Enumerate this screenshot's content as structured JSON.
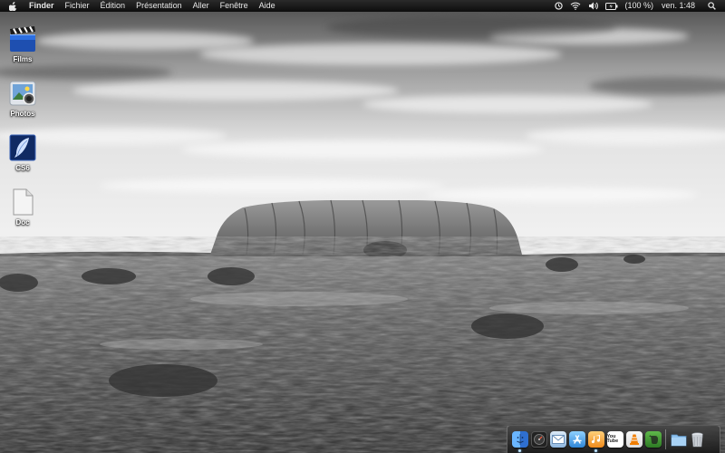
{
  "menubar": {
    "app_name": "Finder",
    "items": [
      "Fichier",
      "Édition",
      "Présentation",
      "Aller",
      "Fenêtre",
      "Aide"
    ],
    "status": {
      "battery": "(100 %)",
      "clock": "ven. 1:48"
    }
  },
  "desktop": {
    "icons": [
      {
        "label": "Films",
        "icon": "clapperboard-icon"
      },
      {
        "label": "Photos",
        "icon": "photos-app-icon"
      },
      {
        "label": "CS6",
        "icon": "feather-icon"
      },
      {
        "label": "Doc",
        "icon": "document-icon"
      }
    ]
  },
  "dock": {
    "apps": [
      {
        "name": "Finder",
        "icon": "finder-icon",
        "color": "#3a7fd5"
      },
      {
        "name": "Dashboard",
        "icon": "dashboard-icon",
        "color": "#2d2d2d"
      },
      {
        "name": "Mail",
        "icon": "mail-icon",
        "color": "#8fb7e0"
      },
      {
        "name": "App Store",
        "icon": "app-store-icon",
        "color": "#4aa3e8"
      },
      {
        "name": "iTunes",
        "icon": "itunes-icon",
        "color": "#f5a623"
      },
      {
        "name": "YouTube",
        "icon": "youtube-icon",
        "label": "You Tube",
        "color": "#d62828"
      },
      {
        "name": "VLC",
        "icon": "vlc-cone-icon",
        "color": "#f07d00"
      },
      {
        "name": "Evernote",
        "icon": "evernote-icon",
        "color": "#3d8c2f"
      },
      {
        "name": "Downloads",
        "icon": "folder-icon",
        "color": "#7fb6e6"
      },
      {
        "name": "Trash",
        "icon": "trash-icon",
        "color": "#b9bfc6"
      }
    ]
  }
}
